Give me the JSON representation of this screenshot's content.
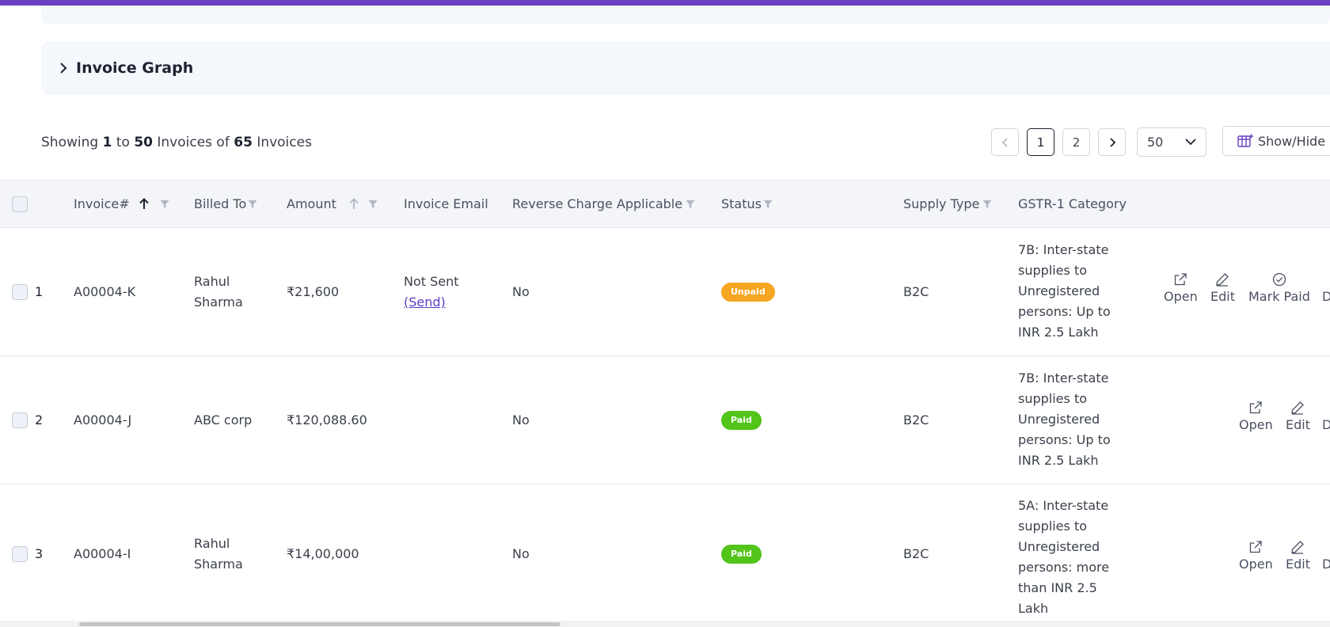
{
  "colors": {
    "accent": "#6a3fc2",
    "unpaid": "#f5a623",
    "paid": "#52c41a",
    "link": "#5b3bc4"
  },
  "graph_section": {
    "title": "Invoice Graph",
    "icon": "chevron-right-icon"
  },
  "summary": {
    "prefix": "Showing",
    "from": "1",
    "to_word": "to",
    "to": "50",
    "label1": "Invoices of",
    "total": "65",
    "label2": "Invoices"
  },
  "pagination": {
    "prev_icon": "chevron-left-icon",
    "pages": [
      "1",
      "2"
    ],
    "current_page": "1",
    "next_icon": "chevron-right-icon",
    "per_page": "50"
  },
  "toolbar": {
    "show_hide_label": "Show/Hide",
    "show_hide_icon": "table-columns-icon"
  },
  "table": {
    "columns": {
      "invoice": "Invoice#",
      "billed_to": "Billed To",
      "amount": "Amount",
      "email": "Invoice Email",
      "reverse_charge": "Reverse Charge Applicable",
      "status": "Status",
      "supply_type": "Supply Type",
      "gstr1": "GSTR-1 Category"
    },
    "rows": [
      {
        "index": "1",
        "invoice": "A00004-K",
        "billed_to": "Rahul Sharma",
        "amount": "₹21,600",
        "email_status": "Not Sent",
        "email_action": "(Send)",
        "reverse_charge": "No",
        "status": "Unpaid",
        "supply_type": "B2C",
        "gstr1": "7B: Inter-state supplies to Unregistered persons: Up to INR 2.5 Lakh",
        "actions": [
          "Open",
          "Edit",
          "Mark Paid",
          "D"
        ]
      },
      {
        "index": "2",
        "invoice": "A00004-J",
        "billed_to": "ABC corp",
        "amount": "₹120,088.60",
        "email_status": "",
        "email_action": "",
        "reverse_charge": "No",
        "status": "Paid",
        "supply_type": "B2C",
        "gstr1": "7B: Inter-state supplies to Unregistered persons: Up to INR 2.5 Lakh",
        "actions": [
          "Open",
          "Edit",
          "D"
        ]
      },
      {
        "index": "3",
        "invoice": "A00004-I",
        "billed_to": "Rahul Sharma",
        "amount": "₹14,00,000",
        "email_status": "",
        "email_action": "",
        "reverse_charge": "No",
        "status": "Paid",
        "supply_type": "B2C",
        "gstr1": "5A: Inter-state supplies to Unregistered persons: more than INR 2.5 Lakh",
        "actions": [
          "Open",
          "Edit",
          "D"
        ]
      }
    ]
  }
}
